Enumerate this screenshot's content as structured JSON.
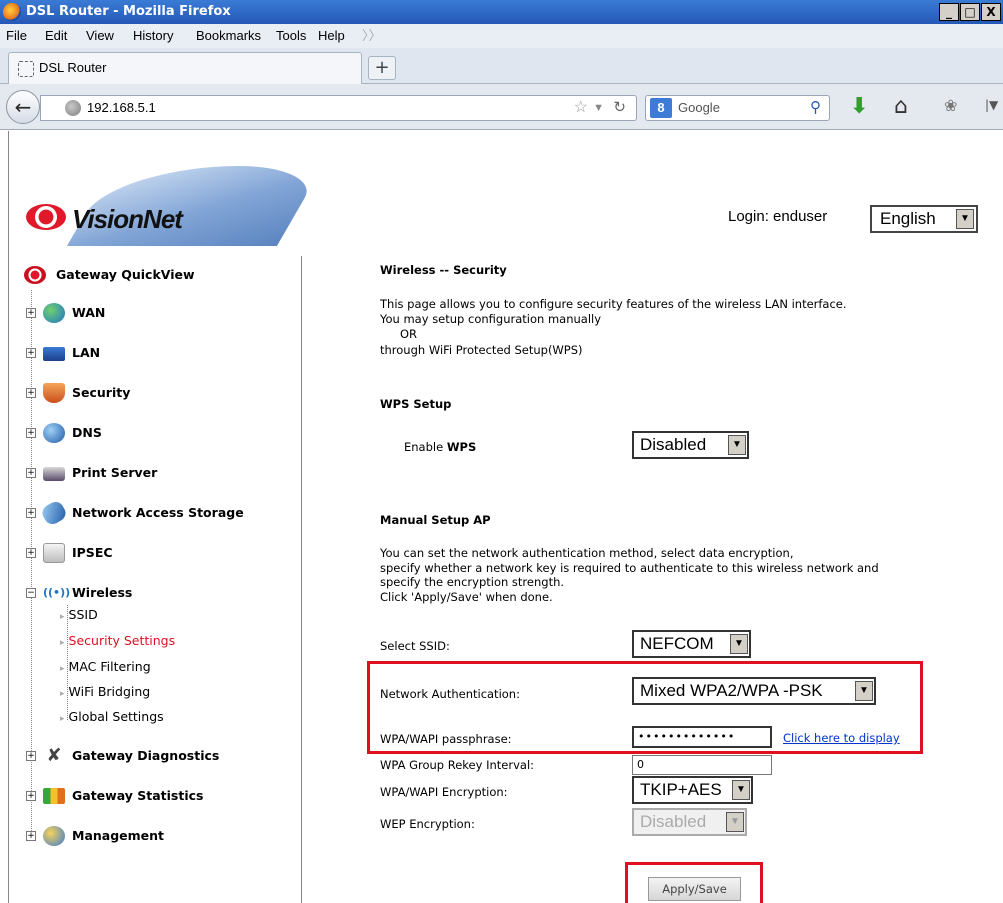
{
  "window": {
    "title": "DSL Router - Mozilla Firefox",
    "buttons": [
      "_",
      "□",
      "X"
    ]
  },
  "menubar": [
    "File",
    "Edit",
    "View",
    "History",
    "Bookmarks",
    "Tools",
    "Help"
  ],
  "tab": {
    "label": "DSL Router",
    "new_tab": "+"
  },
  "navbar": {
    "url": "192.168.5.1",
    "search_engine": "Google"
  },
  "header": {
    "brand": "VisionNet",
    "login": "Login: enduser",
    "language": "English"
  },
  "sidebar": {
    "quickview": "Gateway QuickView",
    "items": [
      {
        "label": "WAN"
      },
      {
        "label": "LAN"
      },
      {
        "label": "Security"
      },
      {
        "label": "DNS"
      },
      {
        "label": "Print Server"
      },
      {
        "label": "Network Access Storage"
      },
      {
        "label": "IPSEC"
      },
      {
        "label": "Wireless"
      },
      {
        "label": "Gateway Diagnostics"
      },
      {
        "label": "Gateway Statistics"
      },
      {
        "label": "Management"
      }
    ],
    "wireless_sub": [
      "SSID",
      "Security Settings",
      "MAC Filtering",
      "WiFi Bridging",
      "Global Settings"
    ]
  },
  "content": {
    "title": "Wireless -- Security",
    "intro": [
      "This page allows you to configure security features of the wireless LAN interface.",
      "You may setup configuration manually",
      "OR",
      "through WiFi Protected Setup(WPS)"
    ],
    "wps_heading": "WPS Setup",
    "enable_wps_prefix": "Enable ",
    "enable_wps_bold": "WPS",
    "wps_value": "Disabled",
    "manual_heading": "Manual Setup AP",
    "manual_desc": [
      "You can set the network authentication method, select data encryption,",
      "specify whether a network key is required to authenticate to this wireless network and",
      "specify the encryption strength.",
      "Click 'Apply/Save' when done."
    ],
    "select_ssid_label": "Select SSID:",
    "select_ssid_value": "NEFCOM",
    "net_auth_label": "Network Authentication:",
    "net_auth_value": "Mixed WPA2/WPA -PSK",
    "passphrase_label": "WPA/WAPI passphrase:",
    "passphrase_value": "•••••••••••••",
    "display_link": "Click here to display",
    "rekey_label": "WPA Group Rekey Interval:",
    "rekey_value": "0",
    "encryption_label": "WPA/WAPI Encryption:",
    "encryption_value": "TKIP+AES",
    "wep_label": "WEP Encryption:",
    "wep_value": "Disabled",
    "apply_button": "Apply/Save"
  },
  "colors": {
    "highlight": "#e01020",
    "link": "#0033cc",
    "titlebar": "#2558b8"
  }
}
